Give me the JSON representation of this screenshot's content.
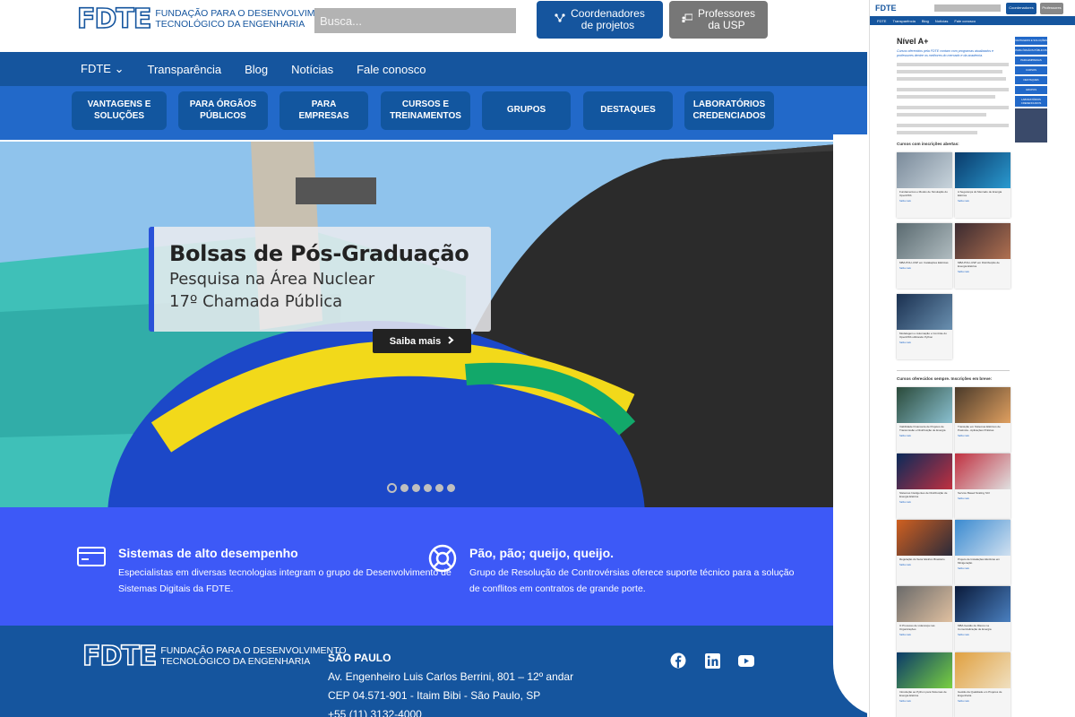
{
  "header": {
    "logo_mark": "FDTE",
    "logo_tagline_1": "FUNDAÇÃO PARA O DESENVOLVIMENTO",
    "logo_tagline_2": "TECNOLÓGICO DA ENGENHARIA",
    "search_placeholder": "Busca...",
    "coord_label_1": "Coordenadores",
    "coord_label_2": "de projetos",
    "prof_label_1": "Professores",
    "prof_label_2": "da USP"
  },
  "nav": {
    "items": [
      "FDTE",
      "Transparência",
      "Blog",
      "Notícias",
      "Fale conosco"
    ],
    "dropdown_glyph": "⌄"
  },
  "categories": [
    {
      "line1": "VANTAGENS E",
      "line2": "SOLUÇÕES"
    },
    {
      "line1": "PARA ÓRGÃOS",
      "line2": "PÚBLICOS"
    },
    {
      "line1": "PARA",
      "line2": "EMPRESAS"
    },
    {
      "line1": "CURSOS E",
      "line2": "TREINAMENTOS"
    },
    {
      "line1": "GRUPOS",
      "line2": ""
    },
    {
      "line1": "DESTAQUES",
      "line2": ""
    },
    {
      "line1": "LABORATÓRIOS",
      "line2": "CREDENCIADOS"
    }
  ],
  "hero": {
    "title": "Bolsas de Pós-Graduação",
    "subtitle": "Pesquisa na Área Nuclear",
    "tagline": "17º Chamada Pública",
    "cta": "Saiba mais",
    "slide_count": 6,
    "active_slide": 1,
    "colors": {
      "sky": "#8fc3ec",
      "ball_blue": "#1c48c8",
      "ball_yellow": "#f2d91a",
      "ball_green": "#12a86a",
      "hull": "#2b2b2b",
      "crane": "#3fc0b8"
    }
  },
  "features": [
    {
      "title": "Sistemas de alto desempenho",
      "desc_1": "Especialistas em diversas tecnologias integram o grupo de Desenvolvimento de",
      "desc_2": "Sistemas Digitais da FDTE."
    },
    {
      "title": "Pão, pão; queijo, queijo.",
      "desc_1": "Grupo de Resolução de Controvérsias oferece suporte técnico para a solução",
      "desc_2": "de conflitos em contratos de grande porte."
    }
  ],
  "footer": {
    "city": "SÃO PAULO",
    "address": "Av. Engenheiro Luis Carlos Berrini, 801 – 12º andar",
    "cep": "CEP 04.571-901 - Itaim Bibi -  São Paulo, SP",
    "phone": "+55 (11) 3132-4000",
    "social": [
      "facebook-icon",
      "linkedin-icon",
      "youtube-icon"
    ]
  },
  "side": {
    "nav": [
      "FDTE",
      "Transparência",
      "Blog",
      "Notícias",
      "Fale conosco"
    ],
    "page_title": "Nível A+",
    "intro": "Cursos oferecidos pela FDTE contam com programas atualizados e professores dentre os melhores do mercado e da academia.",
    "menu": [
      "VANTAGENS E SOLUÇÕES",
      "PARA ÓRGÃOS PÚBLICOS",
      "PARA EMPRESAS",
      "CURSOS",
      "DESTAQUES",
      "GRUPOS",
      "LABORATÓRIOS CREDENCIADOS"
    ],
    "section_open": "Cursos com inscrições abertas:",
    "section_always": "Cursos oferecidos sempre. Inscrições em breve:",
    "saiba": "Saiba mais",
    "open_courses": [
      "Fundamentos e Modos de Simulação do OpenDSS",
      "A Segurança do Mercado de Energia Elétrica",
      "MBA POLI-USP em Instalações Elétricas",
      "MBA POLI-USP em Distribuição de Energia Elétrica",
      "Modelagem e Automação e Controle do OpenDSS utilizando Python"
    ],
    "always_courses": [
      "Viabilidade Financeira de Projetos de Transmissão e Distribuição de Energia",
      "Transição em Sistemas Elétricos de Potência - Aplicações Práticas",
      "Sistemas Inteligentes de Distribuição de Energia Elétrica",
      "Service Based Scaling SCI",
      "Regulação do Setor Elétrico Brasileiro",
      "Projeto de Instalações Elétricas em Minigeração",
      "O Processo de Liderança nas Organizações",
      "MBA Gestão de Riscos na Comercialização de Energia",
      "Introdução ao Python para Sistemas de Energia Elétrica",
      "Gestão da Qualidade em Projetos de Engenharia"
    ]
  }
}
